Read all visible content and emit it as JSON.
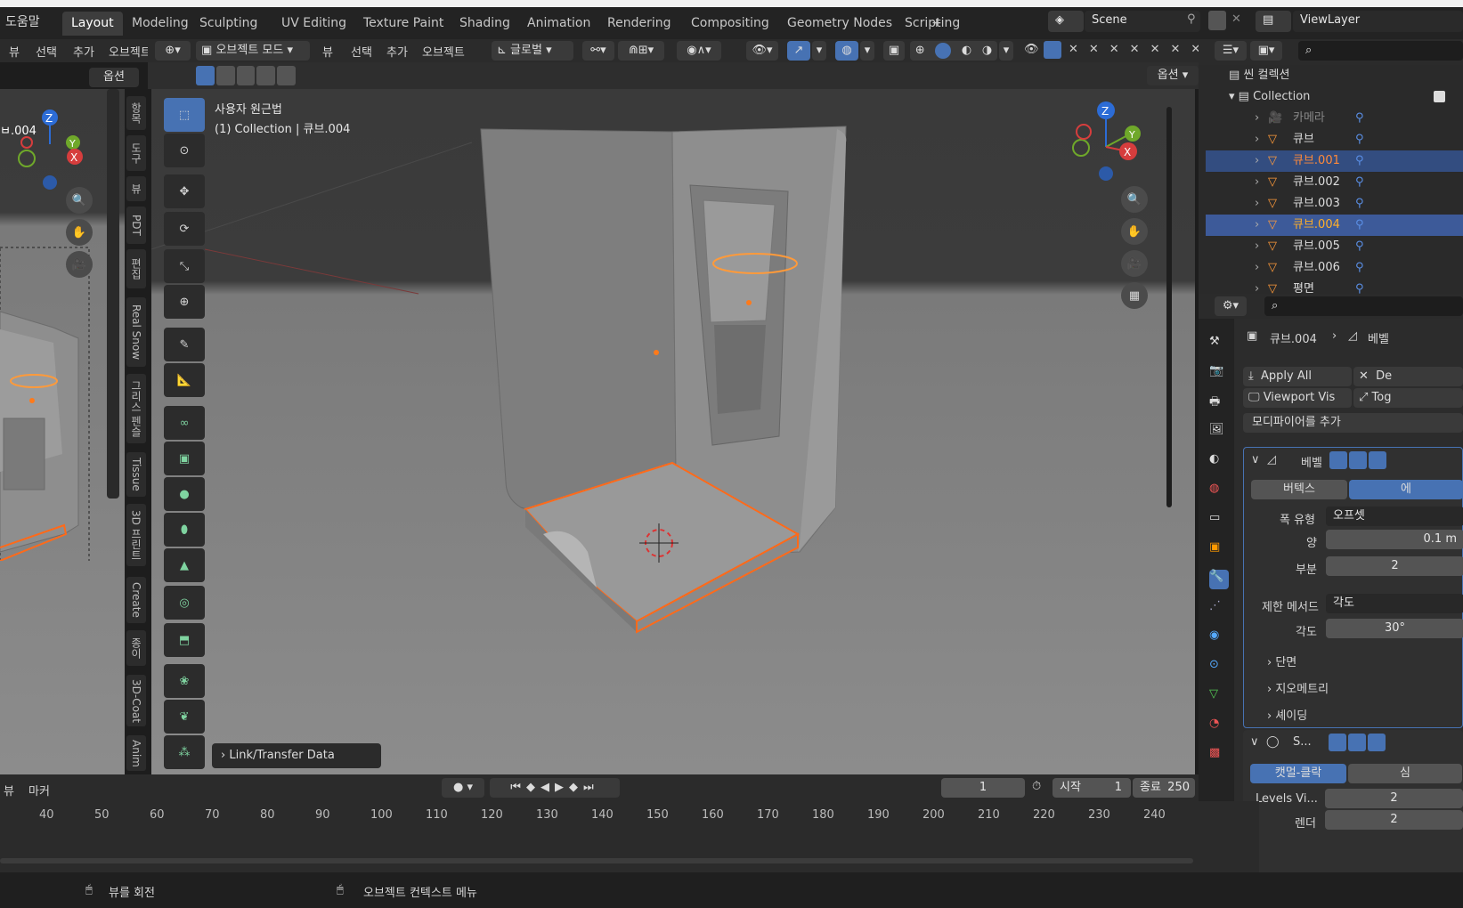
{
  "menu": {
    "help": "도움말"
  },
  "workspace_tabs": [
    "Layout",
    "Modeling",
    "Sculpting",
    "UV Editing",
    "Texture Paint",
    "Shading",
    "Animation",
    "Rendering",
    "Compositing",
    "Geometry Nodes",
    "Scripting"
  ],
  "add_tab": "+",
  "scene": {
    "name": "Scene"
  },
  "view_layer": {
    "name": "ViewLayer"
  },
  "left_header": {
    "view": "뷰",
    "select": "선택",
    "add": "추가",
    "object": "오브젝트"
  },
  "left_options": "옵션",
  "left_label": "ㅂ.004",
  "viewport_header": {
    "mode": "오브젝트 모드",
    "view": "뷰",
    "select": "선택",
    "add": "추가",
    "object": "오브젝트",
    "transform": "글로벌",
    "options": "옵션"
  },
  "viewport_info": {
    "line1": "사용자 원근법",
    "line2": "(1) Collection | 큐브.004"
  },
  "operator_panel": "Link/Transfer Data",
  "side_tabs_main": [
    "항목",
    "도구",
    "뷰",
    "PDT",
    "편집",
    "Real Snow",
    "그리스 펜슬",
    "Tissue",
    "3D 프린트",
    "Create",
    "종이",
    "3D-Coat",
    "Anim"
  ],
  "side_tabs_left": [
    "항목",
    "도구",
    "뷰",
    "PDT",
    "편집",
    "Real Snow",
    "그리스 펜슬",
    "Tissue",
    "3D 프린트",
    "Create",
    "종이",
    "3D-Coat",
    "Anim"
  ],
  "outliner": {
    "scene_collection": "씬 컬렉션",
    "collection": "Collection",
    "items": [
      {
        "name": "카메라",
        "selected": false,
        "active": false
      },
      {
        "name": "큐브",
        "selected": false,
        "active": false
      },
      {
        "name": "큐브.001",
        "selected": true,
        "active": false
      },
      {
        "name": "큐브.002",
        "selected": false,
        "active": false
      },
      {
        "name": "큐브.003",
        "selected": false,
        "active": false
      },
      {
        "name": "큐브.004",
        "selected": true,
        "active": true
      },
      {
        "name": "큐브.005",
        "selected": false,
        "active": false
      },
      {
        "name": "큐브.006",
        "selected": false,
        "active": false
      },
      {
        "name": "평면",
        "selected": false,
        "active": false
      }
    ]
  },
  "properties": {
    "object_name": "큐브.004",
    "modifier_crumb": "베벨",
    "apply_all": "Apply All",
    "delete_all": "De",
    "viewport_vis": "Viewport Vis",
    "toggle": "Tog",
    "add_modifier": "모디파이어를 추가",
    "bevel": {
      "name": "베벨",
      "vertices": "버텍스",
      "edges": "에",
      "width_type_label": "폭 유형",
      "width_type": "오프셋",
      "amount_label": "양",
      "amount": "0.1 m",
      "segments_label": "부분",
      "segments": "2",
      "limit_method_label": "제한 메서드",
      "limit_method": "각도",
      "angle_label": "각도",
      "angle": "30°",
      "profile": "단면",
      "geometry": "지오메트리",
      "shading": "셰이딩"
    },
    "subsurf": {
      "name": "S...",
      "catmull": "캣멀-클락",
      "simple": "심",
      "levels_label": "Levels Vi...",
      "levels": "2",
      "render_label": "렌더",
      "render": "2"
    }
  },
  "timeline": {
    "view": "뷰",
    "marker": "마커",
    "current_frame": "1",
    "start_label": "시작",
    "start": "1",
    "end_label": "종료",
    "end": "250",
    "ruler": [
      "40",
      "50",
      "60",
      "70",
      "80",
      "90",
      "100",
      "110",
      "120",
      "130",
      "140",
      "150",
      "160",
      "170",
      "180",
      "190",
      "200",
      "210",
      "220",
      "230",
      "240"
    ]
  },
  "status": {
    "rotate": "뷰를 회전",
    "context": "오브젝트 컨텍스트 메뉴"
  },
  "colors": {
    "accent": "#4772b3",
    "selection": "#ff6a1a",
    "active_text": "#ffaf29"
  }
}
